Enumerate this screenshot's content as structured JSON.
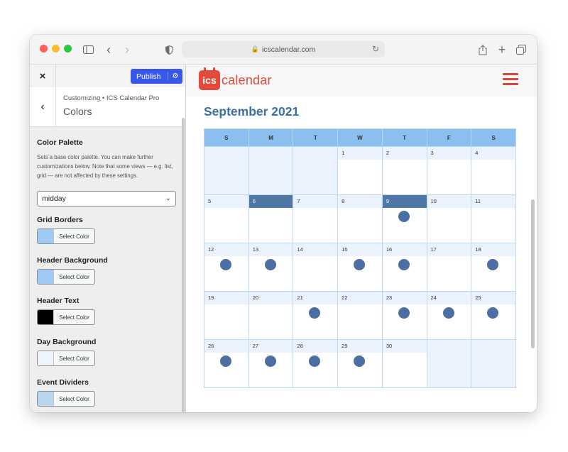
{
  "browser": {
    "url": "icscalendar.com",
    "traffic_lights": [
      "#fe5f57",
      "#febc2e",
      "#28c840"
    ]
  },
  "customizer": {
    "close_icon": "×",
    "publish_label": "Publish",
    "publish_gear_icon": "gear-icon",
    "back_icon": "‹",
    "breadcrumb": "Customizing • ICS Calendar Pro",
    "section_title": "Colors",
    "palette": {
      "label": "Color Palette",
      "description": "Sets a base color palette. You can make further customizations below. Note that some views — e.g. list, grid — are not affected by these settings.",
      "value": "midday"
    },
    "color_controls": [
      {
        "label": "Grid Borders",
        "button": "Select Color",
        "swatch": "#9fcaf4"
      },
      {
        "label": "Header Background",
        "button": "Select Color",
        "swatch": "#9fcaf4"
      },
      {
        "label": "Header Text",
        "button": "Select Color",
        "swatch": "#000000"
      },
      {
        "label": "Day Background",
        "button": "Select Color",
        "swatch": "#edf4fc"
      },
      {
        "label": "Event Dividers",
        "button": "Select Color",
        "swatch": "#b8d6ec"
      }
    ]
  },
  "preview": {
    "logo_badge": "ics",
    "logo_text": "calendar",
    "month_title": "September 2021",
    "weekdays": [
      "S",
      "M",
      "T",
      "W",
      "T",
      "F",
      "S"
    ],
    "weeks": [
      [
        null,
        null,
        null,
        1,
        2,
        3,
        4
      ],
      [
        5,
        6,
        7,
        8,
        9,
        10,
        11
      ],
      [
        12,
        13,
        14,
        15,
        16,
        17,
        18
      ],
      [
        19,
        20,
        21,
        22,
        23,
        24,
        25
      ],
      [
        26,
        27,
        28,
        29,
        30,
        null,
        null
      ]
    ],
    "highlighted_days": [
      6,
      9
    ],
    "event_days": [
      9,
      12,
      13,
      15,
      16,
      18,
      21,
      23,
      24,
      25,
      26,
      27,
      28,
      29
    ],
    "accent_color": "#e24a3b",
    "event_color": "#4b6fa2"
  }
}
